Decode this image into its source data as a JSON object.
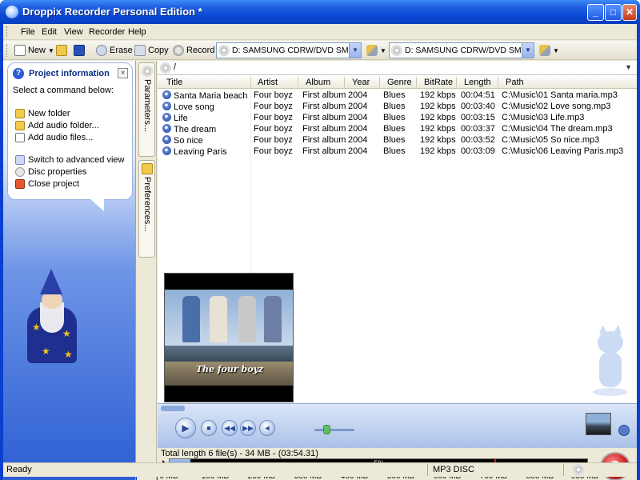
{
  "window": {
    "title": "Droppix Recorder Personal Edition *",
    "minimize_label": "_",
    "maximize_label": "□",
    "close_label": "✕"
  },
  "menu": [
    "File",
    "Edit",
    "View",
    "Recorder",
    "Help"
  ],
  "toolbar": {
    "new_label": "New",
    "erase_label": "Erase",
    "copy_label": "Copy",
    "record_label": "Record",
    "drive_source": "D: SAMSUNG CDRW/DVD SM-352FT9",
    "drive_target": "D: SAMSUNG CDRW/DVD SM-352FT9"
  },
  "project_info": {
    "title": "Project information",
    "subtitle": "Select a command below:",
    "close_label": "×",
    "commands": [
      {
        "label": "New folder",
        "icon": "folder-icon"
      },
      {
        "label": "Add audio folder...",
        "icon": "folder-add-icon"
      },
      {
        "label": "Add audio files...",
        "icon": "file-add-icon"
      },
      {
        "label": "Switch to advanced view",
        "icon": "advanced-view-icon"
      },
      {
        "label": "Disc properties",
        "icon": "disc-properties-icon"
      },
      {
        "label": "Close project",
        "icon": "close-project-icon"
      }
    ]
  },
  "side_tabs": [
    "Parameters...",
    "Preferences..."
  ],
  "path": "/",
  "columns": [
    "Title",
    "Artist",
    "Album",
    "Year",
    "Genre",
    "BitRate",
    "Length",
    "Path"
  ],
  "tracks": [
    {
      "title": "Santa Maria beach",
      "artist": "Four boyz",
      "album": "First album",
      "year": "2004",
      "genre": "Blues",
      "bitrate": "192 kbps",
      "length": "00:04:51",
      "path": "C:\\Music\\01 Santa maria.mp3"
    },
    {
      "title": "Love song",
      "artist": "Four boyz",
      "album": "First album",
      "year": "2004",
      "genre": "Blues",
      "bitrate": "192 kbps",
      "length": "00:03:40",
      "path": "C:\\Music\\02 Love song.mp3"
    },
    {
      "title": "Life",
      "artist": "Four boyz",
      "album": "First album",
      "year": "2004",
      "genre": "Blues",
      "bitrate": "192 kbps",
      "length": "00:03:15",
      "path": "C:\\Music\\03 Life.mp3"
    },
    {
      "title": "The dream",
      "artist": "Four boyz",
      "album": "First album",
      "year": "2004",
      "genre": "Blues",
      "bitrate": "192 kbps",
      "length": "00:03:37",
      "path": "C:\\Music\\04 The dream.mp3"
    },
    {
      "title": "So nice",
      "artist": "Four boyz",
      "album": "First album",
      "year": "2004",
      "genre": "Blues",
      "bitrate": "192 kbps",
      "length": "00:03:52",
      "path": "C:\\Music\\05 So nice.mp3"
    },
    {
      "title": "Leaving Paris",
      "artist": "Four boyz",
      "album": "First album",
      "year": "2004",
      "genre": "Blues",
      "bitrate": "192 kbps",
      "length": "00:03:09",
      "path": "C:\\Music\\06 Leaving Paris.mp3"
    }
  ],
  "cover": {
    "text": "The four boyz"
  },
  "capacity": {
    "total_text": "Total length 6 file(s) - 34 MB - (03:54.31)",
    "percent_label": "5%",
    "fill_fraction": 0.05,
    "limit_fraction": 0.778,
    "ticks": [
      "0 MB",
      "100 MB",
      "200 MB",
      "300 MB",
      "400 MB",
      "500 MB",
      "600 MB",
      "700 MB",
      "800 MB",
      "900 MB"
    ]
  },
  "status": {
    "left": "Ready",
    "disc_type": "MP3 DISC"
  },
  "colors": {
    "titlebar": "#0a46d4",
    "panel_accent": "#2d5fd4",
    "capacity_limit": "#c01818"
  }
}
